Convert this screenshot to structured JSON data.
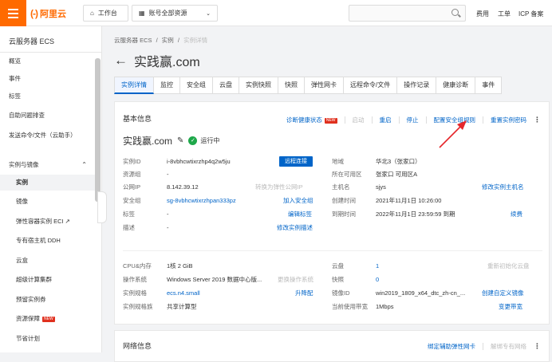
{
  "header": {
    "logo_text": "阿里云",
    "workbench": "工作台",
    "account_scope": "账号全部资源",
    "links": [
      "费用",
      "工单",
      "ICP 备案"
    ]
  },
  "sidebar": {
    "title": "云服务器 ECS",
    "items": [
      {
        "label": "概览"
      },
      {
        "label": "事件"
      },
      {
        "label": "标签"
      },
      {
        "label": "自助问题排查"
      },
      {
        "label": "发送命令/文件（云助手）"
      },
      {
        "label": "实例与镜像"
      },
      {
        "label": "实例"
      },
      {
        "label": "镜像"
      },
      {
        "label": "弹性容器实例 ECI ↗"
      },
      {
        "label": "专有宿主机 DDH"
      },
      {
        "label": "云盒"
      },
      {
        "label": "超级计算集群"
      },
      {
        "label": "预留实例券"
      },
      {
        "label": "资源保障",
        "badge": "NEW"
      },
      {
        "label": "节省计划"
      }
    ]
  },
  "breadcrumb": [
    "云服务器 ECS",
    "/",
    "实例",
    "/",
    "实例详情"
  ],
  "page": {
    "title": "实践赢.com"
  },
  "tabs": [
    "实例详情",
    "监控",
    "安全组",
    "云盘",
    "实例快照",
    "快照",
    "弹性网卡",
    "远程命令/文件",
    "操作记录",
    "健康诊断",
    "事件"
  ],
  "basic": {
    "title": "基本信息",
    "actions": {
      "diagnose": "诊断健康状态",
      "diagnose_badge": "NEW",
      "start": "启动",
      "restart": "重启",
      "stop": "停止",
      "sg_rule": "配置安全组规则",
      "reset_pwd": "重置实例密码",
      "more": "⋮"
    },
    "instance_name": "实践赢.com",
    "status": "运行中",
    "left": [
      {
        "label": "实例ID",
        "value": "i-8vbhcwtixrzhp4q2w5ju",
        "button": "远程连接"
      },
      {
        "label": "资源组",
        "value": "-"
      },
      {
        "label": "公网IP",
        "value": "8.142.39.12",
        "action": "转换为弹性公网IP"
      },
      {
        "label": "安全组",
        "value": "sg-8vbhcwtixrzhpan333pz",
        "action": "加入安全组"
      },
      {
        "label": "标签",
        "value": "-",
        "action": "编辑标签"
      },
      {
        "label": "描述",
        "value": "-",
        "action": "修改实例描述"
      }
    ],
    "right": [
      {
        "label": "地域",
        "value": "华北3（张家口）"
      },
      {
        "label": "所在可用区",
        "value": "张家口 可用区A"
      },
      {
        "label": "主机名",
        "value": "sjys",
        "action": "修改实例主机名"
      },
      {
        "label": "创建时间",
        "value": "2021年11月1日 10:26:00"
      },
      {
        "label": "到期时间",
        "value": "2022年11月1日 23:59:59 到期",
        "action": "续费"
      }
    ],
    "spec_left": [
      {
        "label": "CPU&内存",
        "value": "1核 2 GiB"
      },
      {
        "label": "操作系统",
        "value": "Windows Server 2019 数据中心版...",
        "action": "更换操作系统"
      },
      {
        "label": "实例规格",
        "value": "ecs.n4.small",
        "action": "升降配"
      },
      {
        "label": "实例规格族",
        "value": "共享计算型"
      }
    ],
    "spec_right": [
      {
        "label": "云盘",
        "value": "1",
        "action": "重新初始化云盘"
      },
      {
        "label": "快照",
        "value": "0"
      },
      {
        "label": "镜像ID",
        "value": "win2019_1809_x64_dtc_zh-cn_...",
        "action": "创建自定义镜像"
      },
      {
        "label": "当前使用带宽",
        "value": "1Mbps",
        "action": "变更带宽"
      }
    ]
  },
  "network": {
    "title": "网络信息",
    "actions": [
      "绑定辅助弹性网卡",
      "解绑专有网络"
    ],
    "more": "⋮"
  },
  "colors": {
    "brand": "#ff6a00",
    "link": "#0064c8",
    "annotation": "#e5262a"
  }
}
